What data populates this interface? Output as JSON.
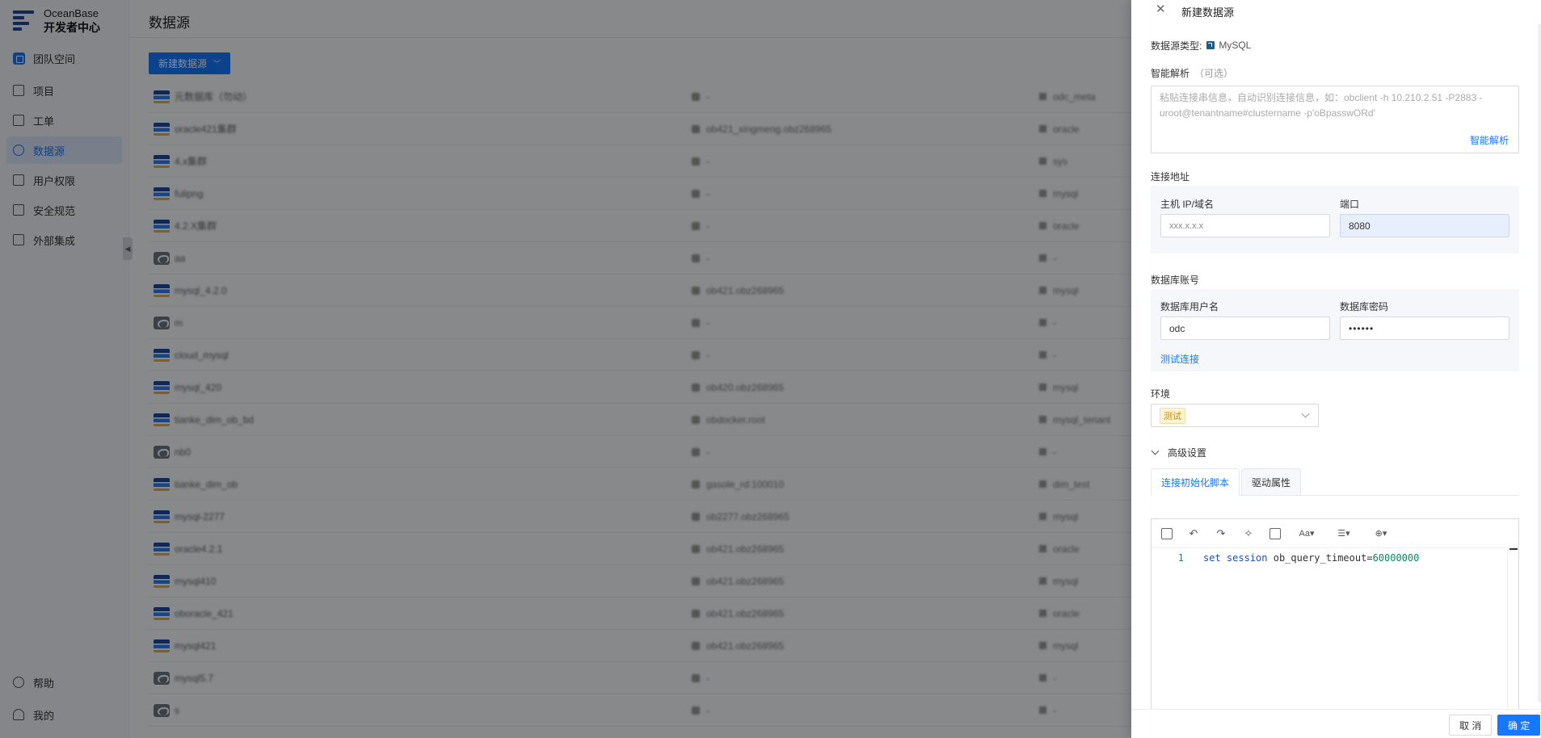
{
  "sidebar": {
    "brand_line1": "OceanBase",
    "brand_line2": "开发者中心",
    "team": "团队空间",
    "items": [
      {
        "label": "项目",
        "icon": "grid-icon"
      },
      {
        "label": "工单",
        "icon": "briefcase-icon"
      },
      {
        "label": "数据源",
        "icon": "link-icon"
      },
      {
        "label": "用户权限",
        "icon": "users-icon"
      },
      {
        "label": "安全规范",
        "icon": "shield-icon"
      },
      {
        "label": "外部集成",
        "icon": "integration-icon"
      }
    ],
    "bottom": [
      {
        "label": "帮助",
        "icon": "bulb-icon"
      },
      {
        "label": "我的",
        "icon": "user-icon"
      }
    ]
  },
  "main": {
    "title": "数据源",
    "new_button": "新建数据源",
    "rows": [
      {
        "name": "元数据库（勿动）",
        "user": "-",
        "tenant": "odc_meta",
        "type": "ob"
      },
      {
        "name": "oracle421集群",
        "user": "ob421_xingmeng.obz268965",
        "tenant": "oracle",
        "type": "ob"
      },
      {
        "name": "4.x集群",
        "user": "-",
        "tenant": "sys",
        "type": "ob"
      },
      {
        "name": "fulipng",
        "user": "-",
        "tenant": "mysql",
        "type": "ob"
      },
      {
        "name": "4.2.X集群",
        "user": "-",
        "tenant": "oracle",
        "type": "ob"
      },
      {
        "name": "aa",
        "user": "-",
        "tenant": "-",
        "type": "mysql"
      },
      {
        "name": "mysql_4.2.0",
        "user": "ob421.obz268965",
        "tenant": "mysql",
        "type": "ob"
      },
      {
        "name": "m",
        "user": "-",
        "tenant": "-",
        "type": "mysql"
      },
      {
        "name": "cloud_mysql",
        "user": "-",
        "tenant": "-",
        "type": "ob"
      },
      {
        "name": "mysql_420",
        "user": "ob420.obz268965",
        "tenant": "mysql",
        "type": "ob"
      },
      {
        "name": "tianke_dim_ob_bd",
        "user": "obdocker.root",
        "tenant": "mysql_tenant",
        "type": "ob"
      },
      {
        "name": "nb0",
        "user": "-",
        "tenant": "-",
        "type": "mysql"
      },
      {
        "name": "tianke_dim_ob",
        "user": "gasole_rd:100010",
        "tenant": "dim_test",
        "type": "ob"
      },
      {
        "name": "mysql-2277",
        "user": "ob2277.obz268965",
        "tenant": "mysql",
        "type": "ob"
      },
      {
        "name": "oracle4.2.1",
        "user": "ob421.obz268965",
        "tenant": "oracle",
        "type": "ob"
      },
      {
        "name": "mysql410",
        "user": "ob421.obz268965",
        "tenant": "mysql",
        "type": "ob"
      },
      {
        "name": "oboracle_421",
        "user": "ob421.obz268965",
        "tenant": "oracle",
        "type": "ob"
      },
      {
        "name": "mysql421",
        "user": "ob421.obz268965",
        "tenant": "mysql",
        "type": "ob"
      },
      {
        "name": "mysql5.7",
        "user": "-",
        "tenant": "-",
        "type": "mysql"
      },
      {
        "name": "s",
        "user": "-",
        "tenant": "-",
        "type": "mysql"
      }
    ]
  },
  "drawer": {
    "title": "新建数据源",
    "type_label": "数据源类型:",
    "type_value": "MySQL",
    "ai_label": "智能解析",
    "ai_optional": "（可选）",
    "ai_placeholder": "粘贴连接串信息，自动识别连接信息，如：obclient -h 10.210.2.51 -P2883 -uroot@tenantname#clustername -p'oBpasswORd'",
    "ai_button": "智能解析",
    "address_label": "连接地址",
    "host_label": "主机 IP/域名",
    "host_placeholder": "xxx.x.x.x",
    "port_label": "端口",
    "port_value": "8080",
    "account_label": "数据库账号",
    "user_label": "数据库用户名",
    "user_value": "odc",
    "password_label": "数据库密码",
    "password_value": "••••••",
    "test_link": "测试连接",
    "env_label": "环境",
    "env_value": "测试",
    "advanced_label": "高级设置",
    "tab_init": "连接初始化脚本",
    "tab_driver": "驱动属性",
    "editor": {
      "line_number": "1",
      "kw1": "set",
      "kw2": "session",
      "ident": "ob_query_timeout",
      "eq": "=",
      "value": "60000000"
    },
    "toolbar": {
      "font_label": "Aa"
    },
    "cancel": "取 消",
    "ok": "确 定"
  },
  "colors": {
    "primary": "#1677ff",
    "overlay": "rgba(0,0,0,0.45)",
    "tag_bg": "#fff3d6",
    "tag_text": "#c48a00"
  }
}
